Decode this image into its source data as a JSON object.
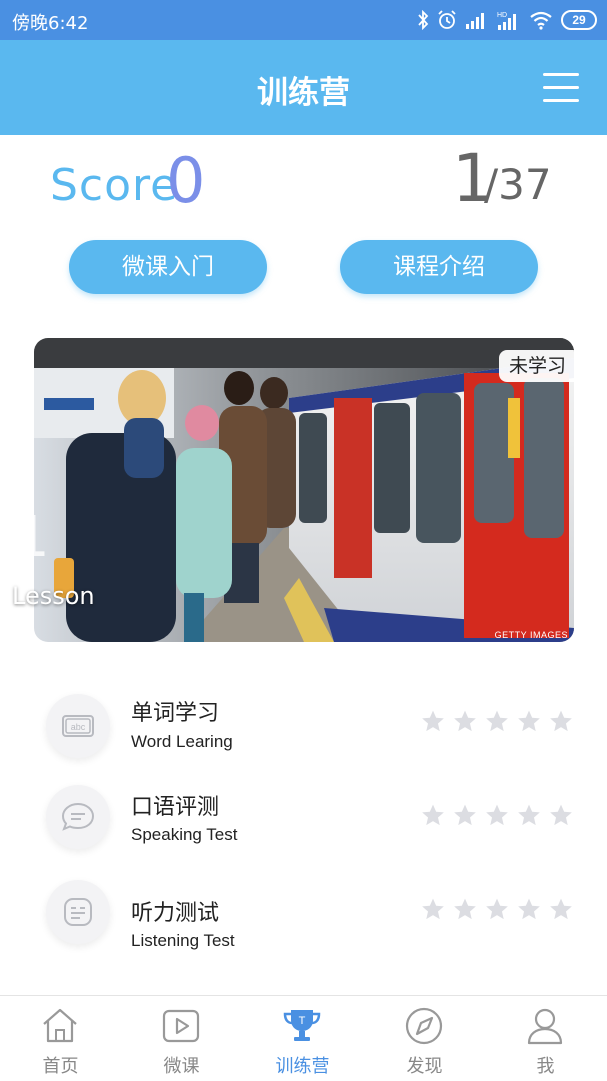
{
  "status_bar": {
    "time": "傍晚6:42",
    "battery": "29"
  },
  "header": {
    "title": "训练营"
  },
  "summary": {
    "score_label": "Score",
    "score_value": "0",
    "progress_current": "1",
    "progress_total": "/37"
  },
  "buttons": {
    "intro_label": "微课入门",
    "course_label": "课程介绍"
  },
  "lesson_card": {
    "status": "未学习",
    "number": "1",
    "label": "Lesson",
    "watermark": "GETTY IMAGES"
  },
  "tasks": [
    {
      "title": "单词学习",
      "subtitle": "Word Learing",
      "icon": "abc-card-icon",
      "stars_filled": 0,
      "stars_total": 5
    },
    {
      "title": "口语评测",
      "subtitle": "Speaking Test",
      "icon": "speech-bubble-icon",
      "stars_filled": 0,
      "stars_total": 5
    },
    {
      "title": "听力测试",
      "subtitle": "Listening Test",
      "icon": "listening-card-icon",
      "stars_filled": 0,
      "stars_total": 5
    }
  ],
  "tabbar": {
    "items": [
      {
        "label": "首页",
        "icon": "home-icon",
        "active": false
      },
      {
        "label": "微课",
        "icon": "play-icon",
        "active": false
      },
      {
        "label": "训练营",
        "icon": "trophy-icon",
        "active": true
      },
      {
        "label": "发现",
        "icon": "compass-icon",
        "active": false
      },
      {
        "label": "我",
        "icon": "user-icon",
        "active": false
      }
    ]
  },
  "colors": {
    "status_bar": "#4a90e2",
    "header": "#5ab8ef",
    "accent": "#5ab8ef",
    "score_value": "#7b8fe8",
    "tab_active": "#4a90e2",
    "star_empty": "#dcdde2"
  }
}
